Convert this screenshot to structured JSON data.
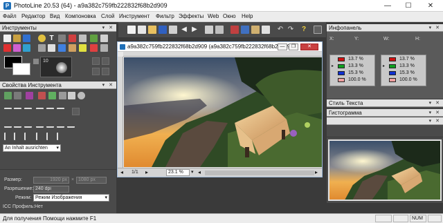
{
  "window": {
    "title": "PhotoLine 20.53 (64) - a9a382c759fb222832f68b2d909",
    "minimize_glyph": "—",
    "maximize_glyph": "☐",
    "close_glyph": "✕"
  },
  "menu": [
    "Файл",
    "Редактор",
    "Вид",
    "Компоновка",
    "Слой",
    "Инструмент",
    "Фильтр",
    "Эффекты",
    "Web",
    "Окно",
    "Help"
  ],
  "tools_panel": {
    "title": "Инструменты",
    "brush_size": "10"
  },
  "tool_props_panel": {
    "title": "Свойства Инструмента",
    "align_select": "An Inhalt ausrichten"
  },
  "document": {
    "title": "a9a382c759fb222832f68b2d909 (a9a382c759fb222832f68b2d909",
    "page_indicator": "1/1",
    "zoom": "23.1 %"
  },
  "doc_info": {
    "size_label": "Размер:",
    "width": "1920 px",
    "times": "×",
    "height": "1080 px",
    "resolution_label": "Разрешение:",
    "resolution": "240 dpi",
    "mode_label": "Режим:",
    "mode": "Режим Изображения",
    "icc_label": "ICC Профиль:",
    "icc": "Нет"
  },
  "info_panel": {
    "title": "Инфопанель",
    "x_label": "X:",
    "y_label": "Y:",
    "w_label": "W:",
    "h_label": "H:",
    "left_values": [
      "13.7 %",
      "13.3 %",
      "15.3 %",
      "100.0 %"
    ],
    "right_values": [
      "13.7 %",
      "13.3 %",
      "15.3 %",
      "100.0 %"
    ],
    "colors": {
      "red": "#d01010",
      "green": "#10a020",
      "blue": "#1030d0"
    }
  },
  "text_style_panel": {
    "title": "Стиль Текста"
  },
  "histogram_panel": {
    "title": "Гистограмма"
  },
  "status": {
    "help_text": "Для получения Помощи нажмите F1",
    "num": "NUM"
  },
  "colors": {
    "accent": "#1e6fb8",
    "panel_bg": "#4a4a4a",
    "workspace_bg": "#3a3a3a"
  }
}
